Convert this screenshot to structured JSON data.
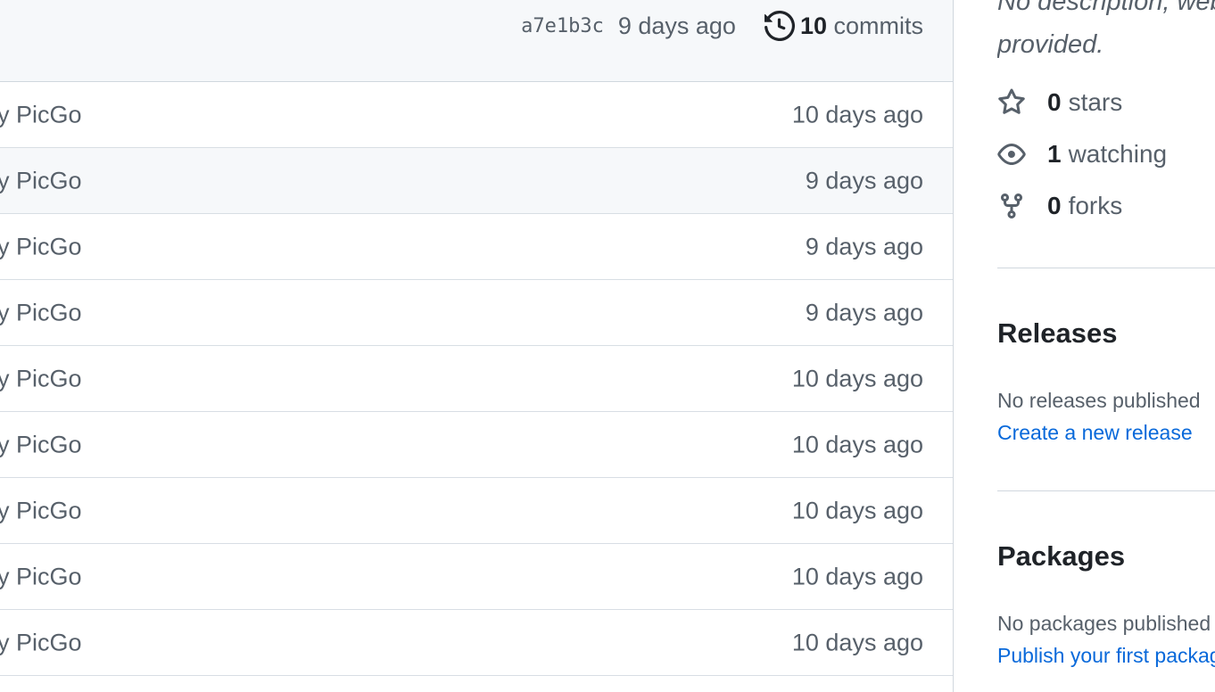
{
  "commit_bar": {
    "sha": "a7e1b3c",
    "time": "9 days ago",
    "commits_count": "10",
    "commits_label": " commits"
  },
  "rows": [
    {
      "message": "by PicGo",
      "age": "10 days ago"
    },
    {
      "message": "by PicGo",
      "age": "9 days ago"
    },
    {
      "message": "by PicGo",
      "age": "9 days ago"
    },
    {
      "message": "by PicGo",
      "age": "9 days ago"
    },
    {
      "message": "by PicGo",
      "age": "10 days ago"
    },
    {
      "message": "by PicGo",
      "age": "10 days ago"
    },
    {
      "message": "by PicGo",
      "age": "10 days ago"
    },
    {
      "message": "by PicGo",
      "age": "10 days ago"
    },
    {
      "message": "by PicGo",
      "age": "10 days ago"
    }
  ],
  "sidebar": {
    "description_line1": "No description, website, or topics",
    "description_line2": "provided.",
    "stars_count": "0",
    "stars_label": "stars",
    "watching_count": "1",
    "watching_label": "watching",
    "forks_count": "0",
    "forks_label": "forks",
    "releases_title": "Releases",
    "releases_text": "No releases published",
    "releases_link": "Create a new release",
    "packages_title": "Packages",
    "packages_text": "No packages published",
    "packages_link": "Publish your first package"
  },
  "colors": {
    "link": "#0969da",
    "muted": "#57606a",
    "border": "#d0d7de",
    "header_bg": "#f6f8fa"
  }
}
